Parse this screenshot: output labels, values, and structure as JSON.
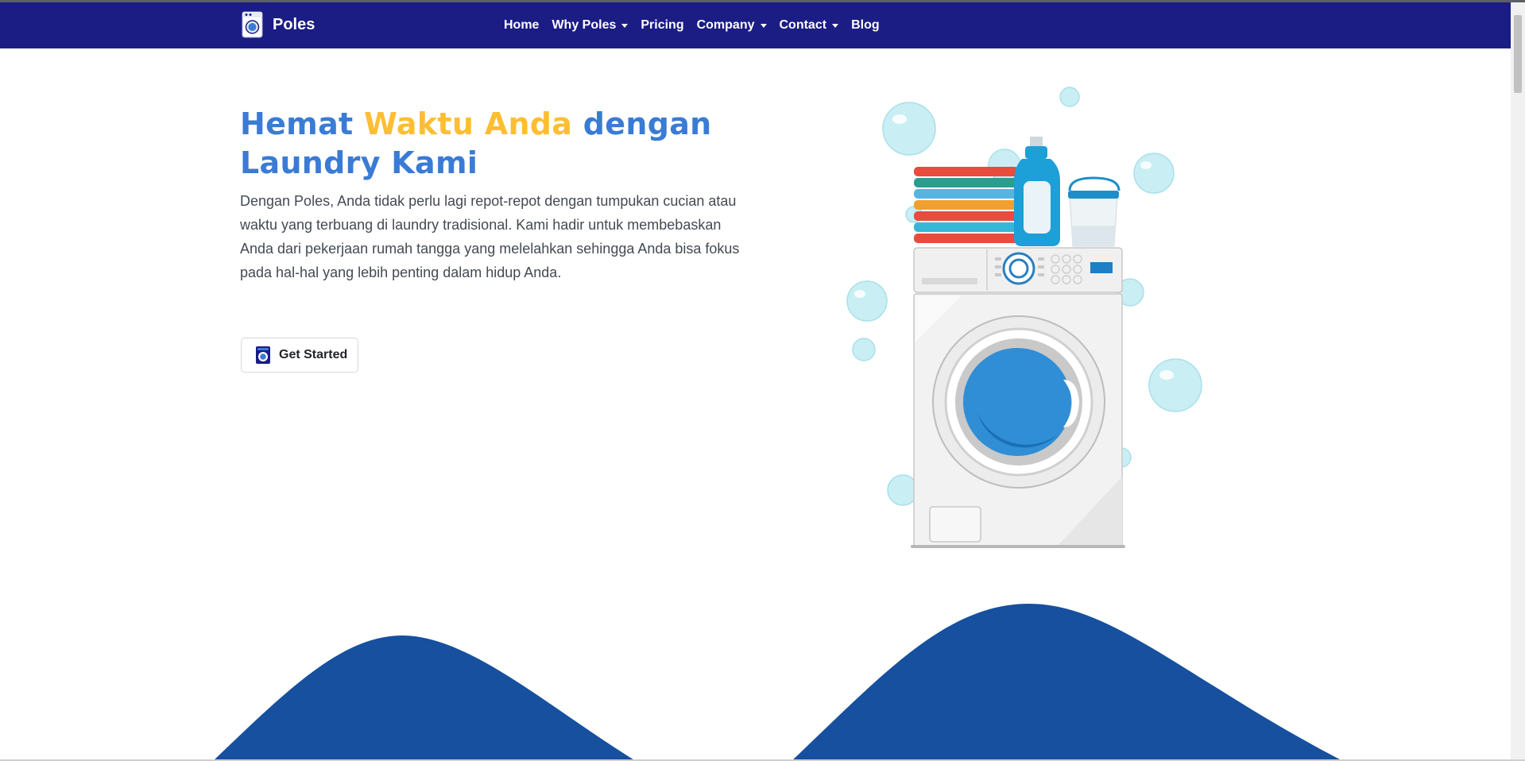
{
  "brand": {
    "name": "Poles",
    "icon": "washing-machine-icon"
  },
  "nav": {
    "items": [
      {
        "label": "Home",
        "dropdown": false
      },
      {
        "label": "Why Poles",
        "dropdown": true
      },
      {
        "label": "Pricing",
        "dropdown": false
      },
      {
        "label": "Company",
        "dropdown": true
      },
      {
        "label": "Contact",
        "dropdown": true
      },
      {
        "label": "Blog",
        "dropdown": false
      }
    ]
  },
  "hero": {
    "title_part1": "Hemat ",
    "title_accent": "Waktu Anda",
    "title_part2": " dengan Laundry Kami",
    "description": "Dengan Poles, Anda tidak perlu lagi repot-repot dengan tumpukan cucian atau waktu yang terbuang di laundry tradisional. Kami hadir untuk membebaskan Anda dari pekerjaan rumah tangga yang melelahkan sehingga Anda bisa fokus pada hal-hal yang lebih penting dalam hidup Anda.",
    "cta_label": "Get Started",
    "cta_icon": "washing-machine-icon"
  },
  "colors": {
    "navbar": "#1b1c84",
    "title_blue": "#3a7bd5",
    "title_accent": "#fdbe34",
    "wave": "#16509f"
  }
}
